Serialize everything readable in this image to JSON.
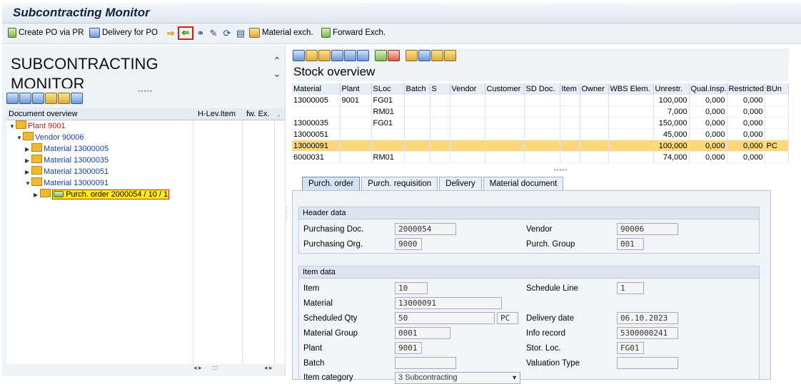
{
  "window": {
    "title": "Subcontracting Monitor"
  },
  "toolbar": {
    "create_po": "Create PO via PR",
    "delivery_po": "Delivery for PO",
    "material_exch": "Material exch.",
    "forward_exch": "Forward Exch."
  },
  "left": {
    "heading": "SUBCONTRACTING MONITOR",
    "columns": [
      "Document overview",
      "H-Lev.Item",
      "fw. Ex.",
      "."
    ],
    "tree": [
      {
        "label": "Plant 9001"
      },
      {
        "label": "Vendor 90006"
      },
      {
        "label": "Material 13000005"
      },
      {
        "label": "Material 13000035"
      },
      {
        "label": "Material 13000051"
      },
      {
        "label": "Material 13000091"
      },
      {
        "label": "Purch. order 2000054 / 10 / 1"
      }
    ]
  },
  "stock": {
    "title": "Stock overview",
    "columns": [
      "Material",
      "Plant",
      "SLoc",
      "Batch",
      "S",
      "Vendor",
      "Customer",
      "SD Doc.",
      "Item",
      "Owner",
      "WBS Elem.",
      "Unrestr.",
      "Qual.Insp.",
      "Restricted",
      "BUn"
    ],
    "rows": [
      [
        "13000005",
        "9001",
        "FG01",
        "",
        "",
        "",
        "",
        "",
        "",
        "",
        "",
        "100,000",
        "0,000",
        "0,000",
        ""
      ],
      [
        "",
        "",
        "RM01",
        "",
        "",
        "",
        "",
        "",
        "",
        "",
        "",
        "7,000",
        "0,000",
        "0,000",
        ""
      ],
      [
        "13000035",
        "",
        "FG01",
        "",
        "",
        "",
        "",
        "",
        "",
        "",
        "",
        "150,000",
        "0,000",
        "0,000",
        ""
      ],
      [
        "13000051",
        "",
        "",
        "",
        "",
        "",
        "",
        "",
        "",
        "",
        "",
        "45,000",
        "0,000",
        "0,000",
        ""
      ],
      [
        "13000091",
        "",
        "",
        "",
        "",
        "",
        "",
        "",
        "",
        "",
        "",
        "100,000",
        "0,000",
        "0,000",
        "PC"
      ],
      [
        "6000031",
        "",
        "RM01",
        "",
        "",
        "",
        "",
        "",
        "",
        "",
        "",
        "74,000",
        "0,000",
        "0,000",
        ""
      ]
    ],
    "highlight_row": 4
  },
  "tabs": [
    "Purch. order",
    "Purch. requisition",
    "Delivery",
    "Material document"
  ],
  "header_data": {
    "title": "Header data",
    "purchasing_doc_label": "Purchasing Doc.",
    "purchasing_doc": "2000054",
    "vendor_label": "Vendor",
    "vendor": "90006",
    "purchasing_org_label": "Purchasing Org.",
    "purchasing_org": "9000",
    "purch_group_label": "Purch. Group",
    "purch_group": "001"
  },
  "item_data": {
    "title": "Item data",
    "item_label": "Item",
    "item": "10",
    "schedule_line_label": "Schedule Line",
    "schedule_line": "1",
    "material_label": "Material",
    "material": "13000091",
    "scheduled_qty_label": "Scheduled Qty",
    "scheduled_qty": "50",
    "unit": "PC",
    "delivery_date_label": "Delivery date",
    "delivery_date": "06.10.2023",
    "material_group_label": "Material Group",
    "material_group": "0001",
    "info_record_label": "Info record",
    "info_record": "5300000241",
    "plant_label": "Plant",
    "plant": "9001",
    "stor_loc_label": "Stor. Loc.",
    "stor_loc": "FG01",
    "batch_label": "Batch",
    "batch": "",
    "valuation_type_label": "Valuation Type",
    "valuation_type": "",
    "item_category_label": "Item category",
    "item_category": "3 Subcontracting"
  }
}
